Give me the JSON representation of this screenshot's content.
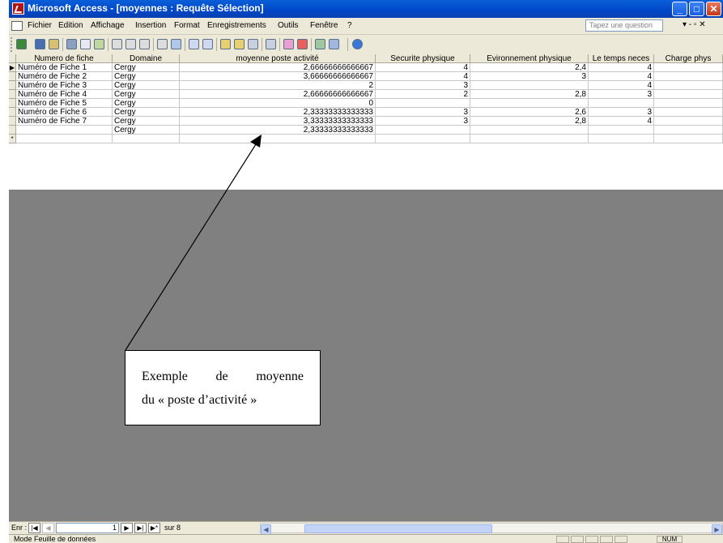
{
  "window": {
    "title": "Microsoft Access - [moyennes : Requête Sélection]",
    "buttons": [
      "_",
      "□",
      "✕"
    ]
  },
  "menu": {
    "items": [
      "Fichier",
      "Edition",
      "Affichage",
      "Insertion",
      "Format",
      "Enregistrements",
      "Outils",
      "Fenêtre",
      "?"
    ],
    "help_placeholder": "Tapez une question",
    "controls": "▾ - ▫ ✕"
  },
  "table": {
    "columns": [
      "Numero de fiche",
      "Domaine",
      "moyenne poste activité",
      "Securite physique",
      "Evironnement physique",
      "Le temps neces",
      "Charge phys"
    ],
    "rows": [
      {
        "marker": "▶",
        "cells": [
          "Numéro de Fiche 1",
          "Cergy",
          "2,66666666666667",
          "4",
          "2,4",
          "4",
          ""
        ]
      },
      {
        "marker": "",
        "cells": [
          "Numéro de Fiche 2",
          "Cergy",
          "3,66666666666667",
          "4",
          "3",
          "4",
          ""
        ]
      },
      {
        "marker": "",
        "cells": [
          "Numéro de Fiche 3",
          "Cergy",
          "2",
          "3",
          "",
          "4",
          ""
        ]
      },
      {
        "marker": "",
        "cells": [
          "Numéro de Fiche 4",
          "Cergy",
          "2,66666666666667",
          "2",
          "2,8",
          "3",
          ""
        ]
      },
      {
        "marker": "",
        "cells": [
          "Numéro de Fiche 5",
          "Cergy",
          "0",
          "",
          "",
          "",
          ""
        ]
      },
      {
        "marker": "",
        "cells": [
          "Numéro de Fiche 6",
          "Cergy",
          "2,33333333333333",
          "3",
          "2,6",
          "3",
          ""
        ]
      },
      {
        "marker": "",
        "cells": [
          "Numéro de Fiche 7",
          "Cergy",
          "3,33333333333333",
          "3",
          "2,8",
          "4",
          ""
        ]
      },
      {
        "marker": "",
        "cells": [
          "",
          "Cergy",
          "2,33333333333333",
          "",
          "",
          "",
          ""
        ]
      },
      {
        "marker": "*",
        "cells": [
          "",
          "",
          "",
          "",
          "",
          "",
          ""
        ]
      }
    ]
  },
  "navigation": {
    "label": "Enr :",
    "current": "1",
    "total_text": "sur 8"
  },
  "status": {
    "text": "Mode Feuille de données",
    "indicator": "NUM"
  },
  "annotation": {
    "line1": "Exemple de moyenne",
    "line2": "du « poste d’activité »"
  }
}
